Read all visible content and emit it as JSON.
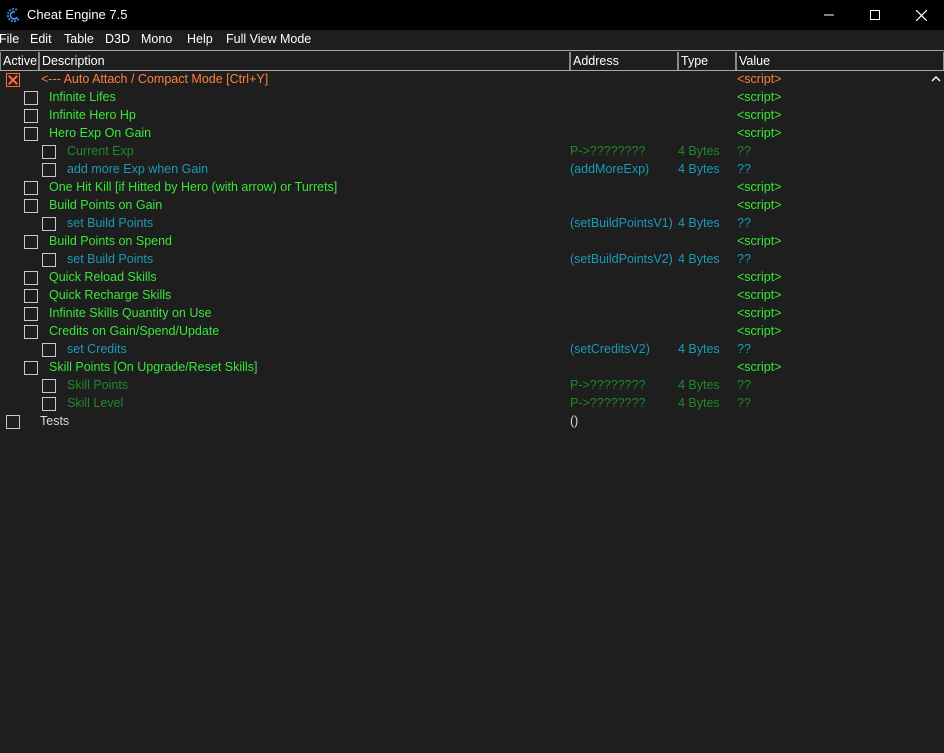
{
  "window": {
    "title": "Cheat Engine 7.5",
    "minimize_icon": "minimize-icon",
    "maximize_icon": "maximize-icon",
    "close_icon": "close-icon"
  },
  "menu": {
    "file": "File",
    "edit": "Edit",
    "table": "Table",
    "d3d": "D3D",
    "mono": "Mono",
    "help": "Help",
    "full_view": "Full View Mode"
  },
  "columns": {
    "active": "Active",
    "description": "Description",
    "address": "Address",
    "type": "Type",
    "value": "Value"
  },
  "colors": {
    "orange": "#ff7f3f",
    "green": "#39e73a",
    "dim_green": "#1d8a2a",
    "teal": "#1b9ab8"
  },
  "rows": [
    {
      "active": true,
      "description": "<--- Auto Attach / Compact Mode [Ctrl+Y]",
      "address": "",
      "type": "",
      "value": "<script>"
    },
    {
      "active": false,
      "description": "Infinite Lifes",
      "address": "",
      "type": "",
      "value": "<script>"
    },
    {
      "active": false,
      "description": "Infinite Hero Hp",
      "address": "",
      "type": "",
      "value": "<script>"
    },
    {
      "active": false,
      "description": "Hero Exp On Gain",
      "address": "",
      "type": "",
      "value": "<script>"
    },
    {
      "active": false,
      "description": "Current Exp",
      "address": "P->????????",
      "type": "4 Bytes",
      "value": "??"
    },
    {
      "active": false,
      "description": "add more Exp when Gain",
      "address": "(addMoreExp)",
      "type": "4 Bytes",
      "value": "??"
    },
    {
      "active": false,
      "description": "One Hit Kill [if Hitted by Hero (with arrow) or Turrets]",
      "address": "",
      "type": "",
      "value": "<script>"
    },
    {
      "active": false,
      "description": "Build Points on Gain",
      "address": "",
      "type": "",
      "value": "<script>"
    },
    {
      "active": false,
      "description": "set Build Points",
      "address": "(setBuildPointsV1)",
      "type": "4 Bytes",
      "value": "??"
    },
    {
      "active": false,
      "description": "Build Points on Spend",
      "address": "",
      "type": "",
      "value": "<script>"
    },
    {
      "active": false,
      "description": "set Build Points",
      "address": "(setBuildPointsV2)",
      "type": "4 Bytes",
      "value": "??"
    },
    {
      "active": false,
      "description": "Quick Reload Skills",
      "address": "",
      "type": "",
      "value": "<script>"
    },
    {
      "active": false,
      "description": "Quick Recharge Skills",
      "address": "",
      "type": "",
      "value": "<script>"
    },
    {
      "active": false,
      "description": "Infinite Skills Quantity on Use",
      "address": "",
      "type": "",
      "value": "<script>"
    },
    {
      "active": false,
      "description": "Credits on Gain/Spend/Update",
      "address": "",
      "type": "",
      "value": "<script>"
    },
    {
      "active": false,
      "description": "set Credits",
      "address": "(setCreditsV2)",
      "type": "4 Bytes",
      "value": "??"
    },
    {
      "active": false,
      "description": "Skill Points [On Upgrade/Reset Skills]",
      "address": "",
      "type": "",
      "value": "<script>"
    },
    {
      "active": false,
      "description": "Skill Points",
      "address": "P->????????",
      "type": "4 Bytes",
      "value": "??"
    },
    {
      "active": false,
      "description": "Skill Level",
      "address": "P->????????",
      "type": "4 Bytes",
      "value": "??"
    },
    {
      "active": false,
      "description": "Tests",
      "address": "()",
      "type": "",
      "value": ""
    }
  ]
}
